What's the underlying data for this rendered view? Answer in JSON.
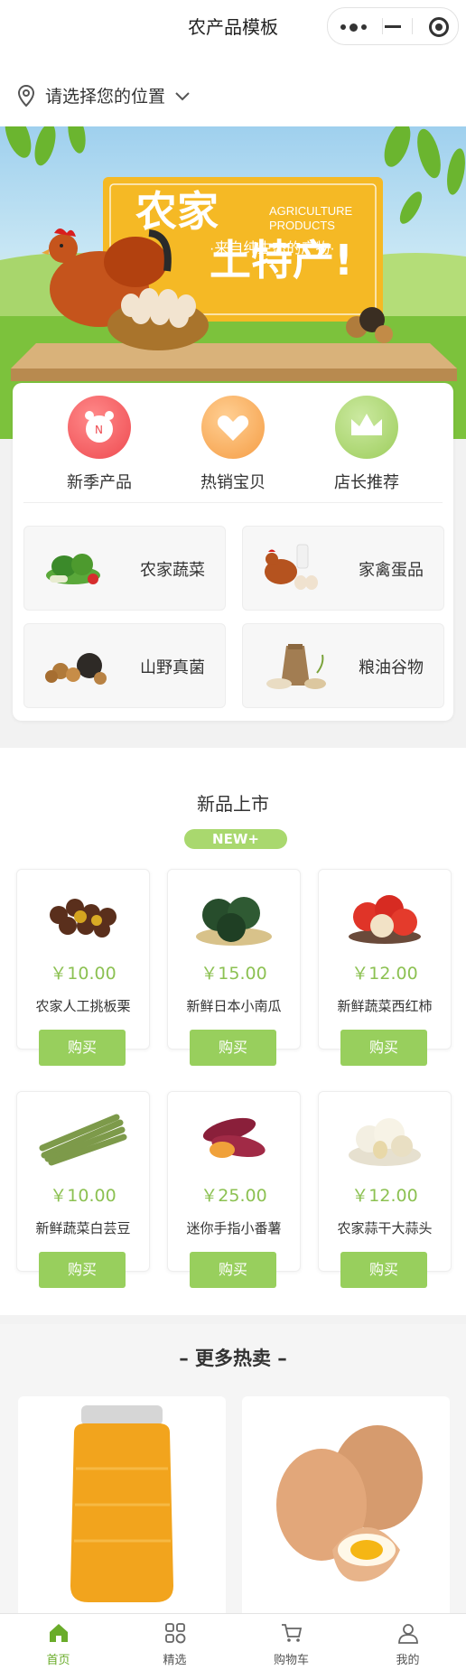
{
  "app": {
    "title": "农产品模板"
  },
  "location": {
    "text": "请选择您的位置"
  },
  "banner": {
    "headline_line1": "农家",
    "headline_line2": "土特产!",
    "en_line1": "AGRICULTURE",
    "en_line2": "PRODUCTS",
    "tagline": "·来自纯生态的产物·",
    "brand_color": "#f5b925"
  },
  "top_categories": [
    {
      "label": "新季产品",
      "icon": "alarm-clock-icon",
      "color": "#f0545a"
    },
    {
      "label": "热销宝贝",
      "icon": "heart-icon",
      "color": "#f7a752"
    },
    {
      "label": "店长推荐",
      "icon": "crown-icon",
      "color": "#a6d46b"
    }
  ],
  "categories": [
    {
      "label": "农家蔬菜",
      "icon": "vegetables-icon"
    },
    {
      "label": "家禽蛋品",
      "icon": "chicken-eggs-icon"
    },
    {
      "label": "山野真菌",
      "icon": "mushroom-icon"
    },
    {
      "label": "粮油谷物",
      "icon": "grain-sack-icon"
    }
  ],
  "new_section": {
    "title": "新品上市",
    "badge": "NEW+",
    "buy_label": "购买",
    "products": [
      {
        "price": "￥10.00",
        "name": "农家人工挑板栗",
        "icon": "chestnut-icon"
      },
      {
        "price": "￥15.00",
        "name": "新鲜日本小南瓜",
        "icon": "pumpkin-icon"
      },
      {
        "price": "￥12.00",
        "name": "新鲜蔬菜西红柿",
        "icon": "tomato-icon"
      },
      {
        "price": "￥10.00",
        "name": "新鲜蔬菜白芸豆",
        "icon": "green-bean-icon"
      },
      {
        "price": "￥25.00",
        "name": "迷你手指小番薯",
        "icon": "sweet-potato-icon"
      },
      {
        "price": "￥12.00",
        "name": "农家蒜干大蒜头",
        "icon": "garlic-icon"
      }
    ]
  },
  "hot_section": {
    "title": "更多热卖",
    "items": [
      {
        "icon": "honey-jar-icon"
      },
      {
        "icon": "eggs-icon"
      }
    ]
  },
  "tabbar": {
    "active_color": "#6aac2a",
    "items": [
      {
        "label": "首页",
        "icon": "home-icon",
        "active": true
      },
      {
        "label": "精选",
        "icon": "grid-icon",
        "active": false
      },
      {
        "label": "购物车",
        "icon": "cart-icon",
        "active": false
      },
      {
        "label": "我的",
        "icon": "user-icon",
        "active": false
      }
    ]
  }
}
